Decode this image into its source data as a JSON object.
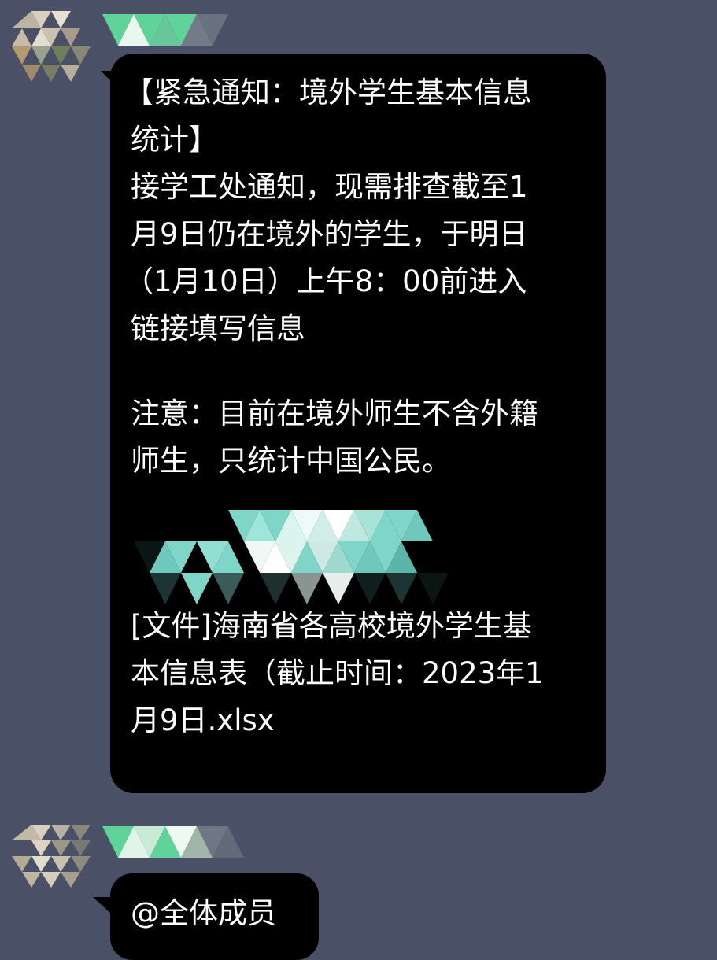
{
  "chat": {
    "messages": [
      {
        "id": "notice",
        "lines": [
          "【紧急通知：境外学生基本信息",
          "统计】",
          "接学工处通知，现需排查截至1",
          "月9日仍在境外的学生，于明日",
          "（1月10日）上午8：00前进入",
          "链接填写信息",
          "注意：目前在境外师生不含外籍",
          "师生，只统计中国公民。"
        ]
      },
      {
        "id": "file",
        "lines": [
          "[文件]海南省各高校境外学生基",
          "本信息表（截止时间：2023年1",
          "月9日.xlsx"
        ]
      },
      {
        "id": "mention",
        "lines": [
          "@全体成员"
        ]
      }
    ]
  },
  "colors": {
    "background": "#4a5066",
    "bubble": "#000000",
    "text": "#ffffff",
    "name_accent": "#5fd39a",
    "redaction_teal": "#7fd6c8"
  }
}
